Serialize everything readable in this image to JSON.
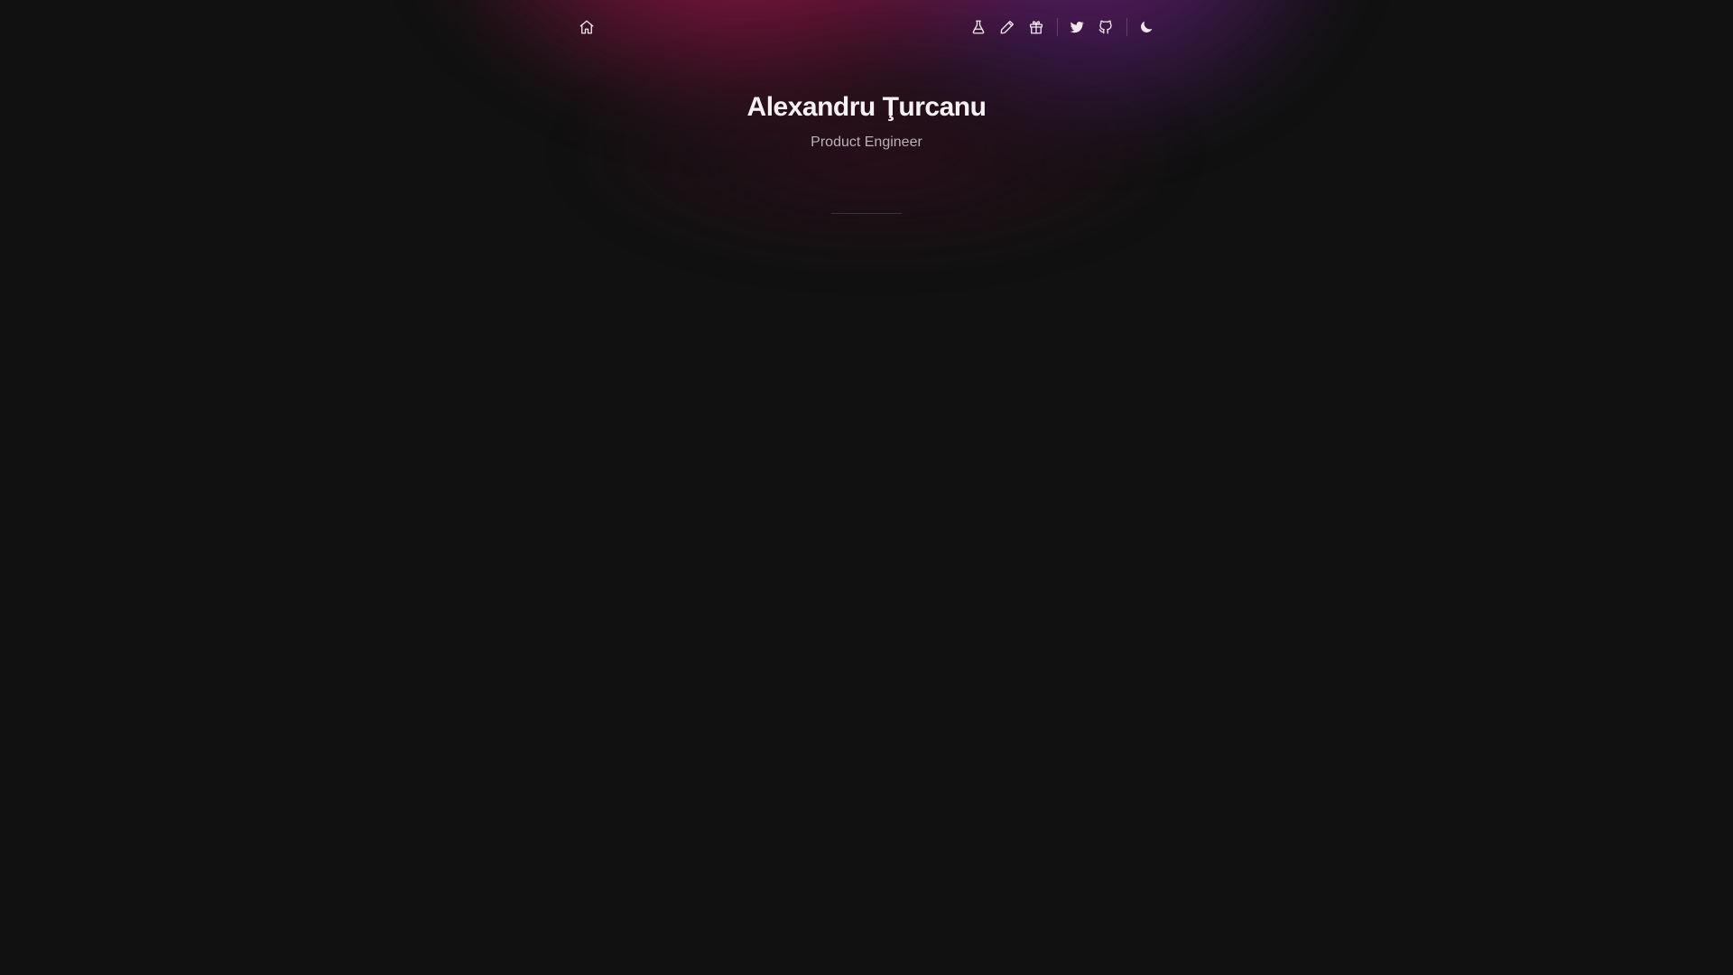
{
  "nav": {
    "left": [
      {
        "icon": "home-icon"
      }
    ],
    "right": [
      {
        "icon": "flask-icon"
      },
      {
        "icon": "pencil-icon"
      },
      {
        "icon": "gift-icon"
      },
      {
        "icon": "twitter-icon"
      },
      {
        "icon": "github-icon"
      },
      {
        "icon": "moon-icon"
      }
    ]
  },
  "header": {
    "name": "Alexandru Ţurcanu",
    "role": "Product Engineer"
  },
  "colors": {
    "background": "#111111",
    "glow_primary": "#961848",
    "glow_secondary": "#5f1e78",
    "title_text": "#f6f2f4",
    "subtitle_text": "#b9b3b6"
  }
}
